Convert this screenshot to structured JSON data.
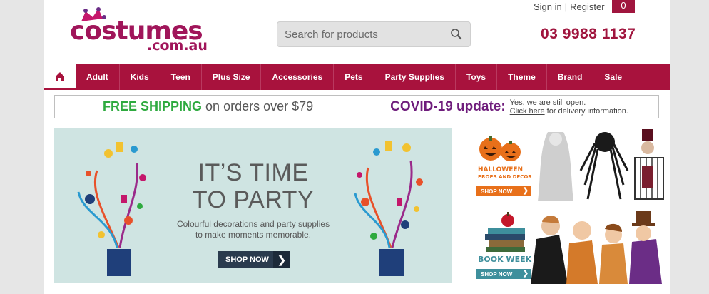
{
  "header": {
    "logo_main": "costumes",
    "logo_sub": ".com.au",
    "search_placeholder": "Search for products",
    "signin_label": "Sign in",
    "separator": "|",
    "register_label": "Register",
    "cart_count": "0",
    "phone": "03 9988 1137"
  },
  "nav": {
    "home_icon": "home-icon",
    "items": [
      "Adult",
      "Kids",
      "Teen",
      "Plus Size",
      "Accessories",
      "Pets",
      "Party Supplies",
      "Toys",
      "Theme",
      "Brand",
      "Sale"
    ]
  },
  "promo": {
    "free_shipping": "FREE SHIPPING",
    "shipping_rest": "on orders over $79",
    "covid_title": "COVID-19 update:",
    "covid_line1": "Yes, we are still open.",
    "covid_link": "Click here",
    "covid_line2_rest": "for delivery information."
  },
  "hero": {
    "title_line1": "IT’S TIME",
    "title_line2": "TO PARTY",
    "subtitle_line1": "Colourful decorations and party supplies",
    "subtitle_line2": "to make moments memorable.",
    "button_label": "SHOP NOW",
    "button_arrow": "❯"
  },
  "side_banners": {
    "halloween_line1": "HALLOWEEN",
    "halloween_line2": "PROPS AND DECOR",
    "halloween_button": "SHOP NOW",
    "book_title": "BOOK WEEK",
    "book_button": "SHOP NOW",
    "button_arrow": "❯"
  },
  "colors": {
    "brand": "#a8123d",
    "logo": "#a0155a",
    "shipping_green": "#2eaa3f",
    "covid_purple": "#6f1d7c",
    "hero_bg": "#cfe4e2",
    "halloween_orange": "#e8701a",
    "book_teal": "#3e8f9c"
  }
}
